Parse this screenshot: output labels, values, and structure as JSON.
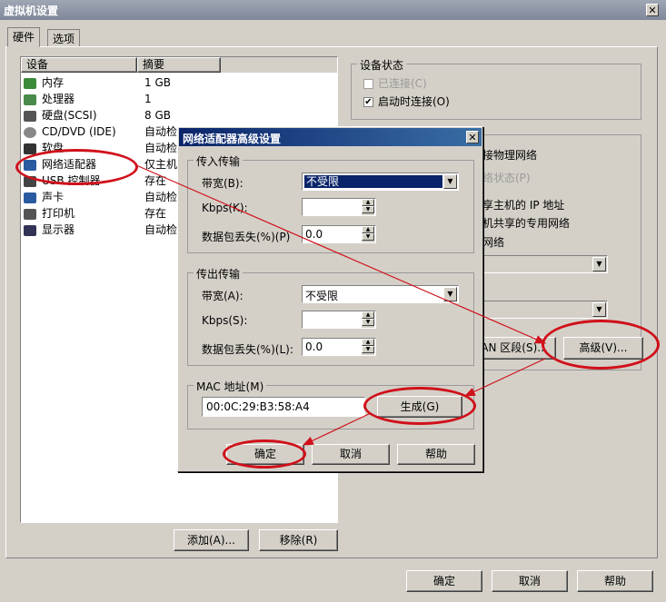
{
  "window": {
    "title": "虚拟机设置"
  },
  "tabs": [
    {
      "label": "硬件"
    },
    {
      "label": "选项"
    }
  ],
  "device_list": {
    "headers": [
      "设备",
      "摘要"
    ],
    "rows": [
      {
        "name": "内存",
        "summary": "1 GB",
        "icon": "memory-icon"
      },
      {
        "name": "处理器",
        "summary": "1",
        "icon": "cpu-icon"
      },
      {
        "name": "硬盘(SCSI)",
        "summary": "8 GB",
        "icon": "harddisk-icon"
      },
      {
        "name": "CD/DVD (IDE)",
        "summary": "自动检",
        "icon": "cd-icon"
      },
      {
        "name": "软盘",
        "summary": "自动检",
        "icon": "floppy-icon"
      },
      {
        "name": "网络适配器",
        "summary": "仅主机",
        "icon": "network-icon"
      },
      {
        "name": "USB 控制器",
        "summary": "存在",
        "icon": "usb-icon"
      },
      {
        "name": "声卡",
        "summary": "自动检",
        "icon": "sound-icon"
      },
      {
        "name": "打印机",
        "summary": "存在",
        "icon": "printer-icon"
      },
      {
        "name": "显示器",
        "summary": "自动检",
        "icon": "display-icon"
      }
    ],
    "add_label": "添加(A)...",
    "remove_label": "移除(R)"
  },
  "device_status": {
    "title": "设备状态",
    "connected": "已连接(C)",
    "connect_at_poweron": "启动时连接(O)"
  },
  "network_partial": {
    "bridged_tail": "接物理网络",
    "replicate_tail": "络状态(P)",
    "nat_tail": "享主机的 IP 地址",
    "hostonly_tail": "机共享的专用网络",
    "custom_tail": "网络",
    "lan_segment_tail": "AN 区段(S)...",
    "advanced_label": "高级(V)..."
  },
  "dialog": {
    "title": "网络适配器高级设置",
    "incoming": {
      "title": "传入传输",
      "bandwidth_label": "带宽(B):",
      "bandwidth_value": "不受限",
      "kbps_label": "Kbps(K):",
      "kbps_value": "",
      "loss_label": "数据包丢失(%)(P)",
      "loss_value": "0.0"
    },
    "outgoing": {
      "title": "传出传输",
      "bandwidth_label": "带宽(A):",
      "bandwidth_value": "不受限",
      "kbps_label": "Kbps(S):",
      "kbps_value": "",
      "loss_label": "数据包丢失(%)(L):",
      "loss_value": "0.0"
    },
    "mac": {
      "title": "MAC 地址(M)",
      "value": "00:0C:29:B3:58:A4",
      "generate_label": "生成(G)"
    },
    "ok_label": "确定",
    "cancel_label": "取消",
    "help_label": "帮助"
  },
  "footer": {
    "ok_label": "确定",
    "cancel_label": "取消",
    "help_label": "帮助"
  },
  "colors": {
    "annotation": "#d0101a",
    "selection": "#0a246a"
  }
}
